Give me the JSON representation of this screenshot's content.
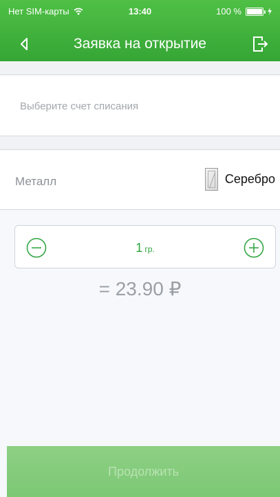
{
  "status_bar": {
    "carrier": "Нет SIM-карты",
    "time": "13:40",
    "battery": "100 %"
  },
  "nav": {
    "title": "Заявка на открытие",
    "back_icon": "chevron-left-icon",
    "exit_icon": "logout-icon"
  },
  "account": {
    "placeholder": "Выберите счет списания"
  },
  "metal": {
    "label": "Металл",
    "value": "Серебро",
    "icon": "silver-bar-icon"
  },
  "stepper": {
    "quantity": "1",
    "unit": "гр.",
    "minus_icon": "minus-circle-icon",
    "plus_icon": "plus-circle-icon"
  },
  "total": "= 23.90 ₽",
  "actions": {
    "continue_label": "Продолжить"
  },
  "colors": {
    "accent": "#35a535",
    "accent_light": "#7cc874",
    "background": "#f6f8fc"
  }
}
